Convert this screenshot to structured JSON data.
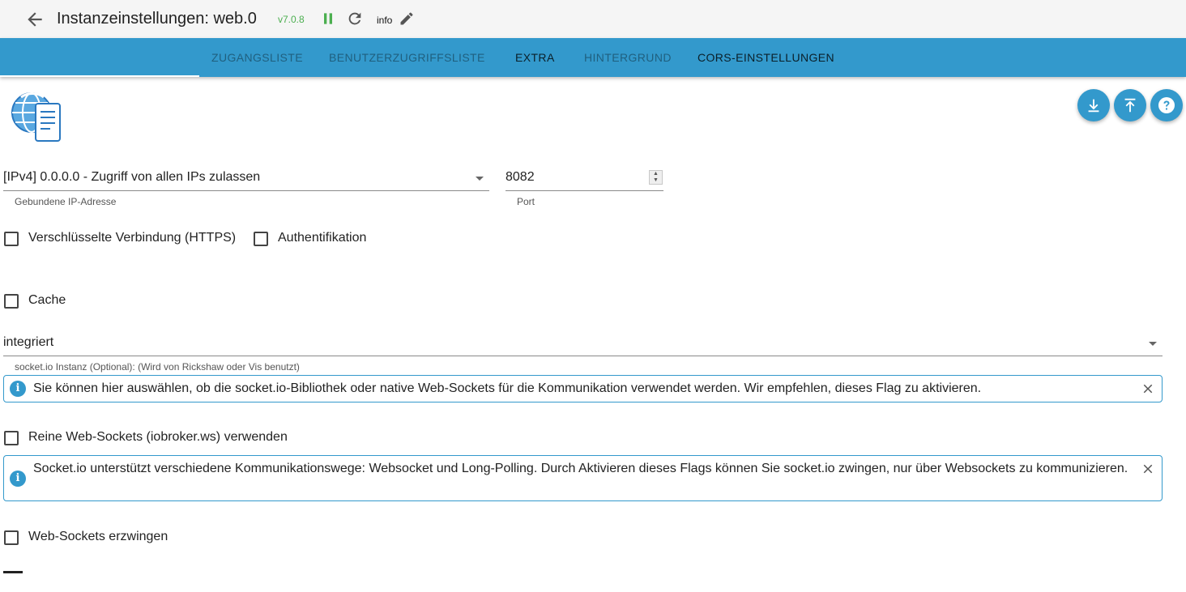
{
  "header": {
    "title": "Instanzeinstellungen: web.0",
    "version": "v7.0.8",
    "log_level": "info"
  },
  "tabs": [
    {
      "label": "ZUGANGSLISTE"
    },
    {
      "label": "BENUTZERZUGRIFFSLISTE"
    },
    {
      "label": "EXTRA"
    },
    {
      "label": "HINTERGRUND"
    },
    {
      "label": "CORS-EINSTELLUNGEN"
    }
  ],
  "icons": {
    "back": "arrow-left-icon",
    "pause": "pause-icon",
    "reload": "reload-icon",
    "edit": "pencil-icon",
    "download": "download-icon",
    "upload": "upload-icon",
    "help": "help-icon",
    "info": "info-icon",
    "close": "close-icon"
  },
  "colors": {
    "accent": "#3399cc",
    "version": "#4caf50"
  },
  "form": {
    "bind": {
      "value": "[IPv4] 0.0.0.0 - Zugriff von allen IPs zulassen",
      "helper": "Gebundene IP-Adresse"
    },
    "port": {
      "value": "8082",
      "helper": "Port"
    },
    "secure": {
      "label": "Verschlüsselte Verbindung (HTTPS)",
      "checked": false
    },
    "auth": {
      "label": "Authentifikation",
      "checked": false
    },
    "cache": {
      "label": "Cache",
      "checked": false
    },
    "socketio": {
      "value": "integriert",
      "helper": "socket.io Instanz (Optional): (Wird von Rickshaw oder Vis benutzt)"
    },
    "info_websockets": "Sie können hier auswählen, ob die socket.io-Bibliothek oder native Web-Sockets für die Kommunikation verwendet werden. Wir empfehlen, dieses Flag zu aktivieren.",
    "pure_websockets": {
      "label": "Reine Web-Sockets (iobroker.ws) verwenden",
      "checked": false
    },
    "info_force": "Socket.io unterstützt verschiedene Kommunikationswege: Websocket und Long-Polling. Durch Aktivieren dieses Flags können Sie socket.io zwingen, nur über Websockets zu kommunizieren.",
    "force_websockets": {
      "label": "Web-Sockets erzwingen",
      "checked": false
    }
  }
}
